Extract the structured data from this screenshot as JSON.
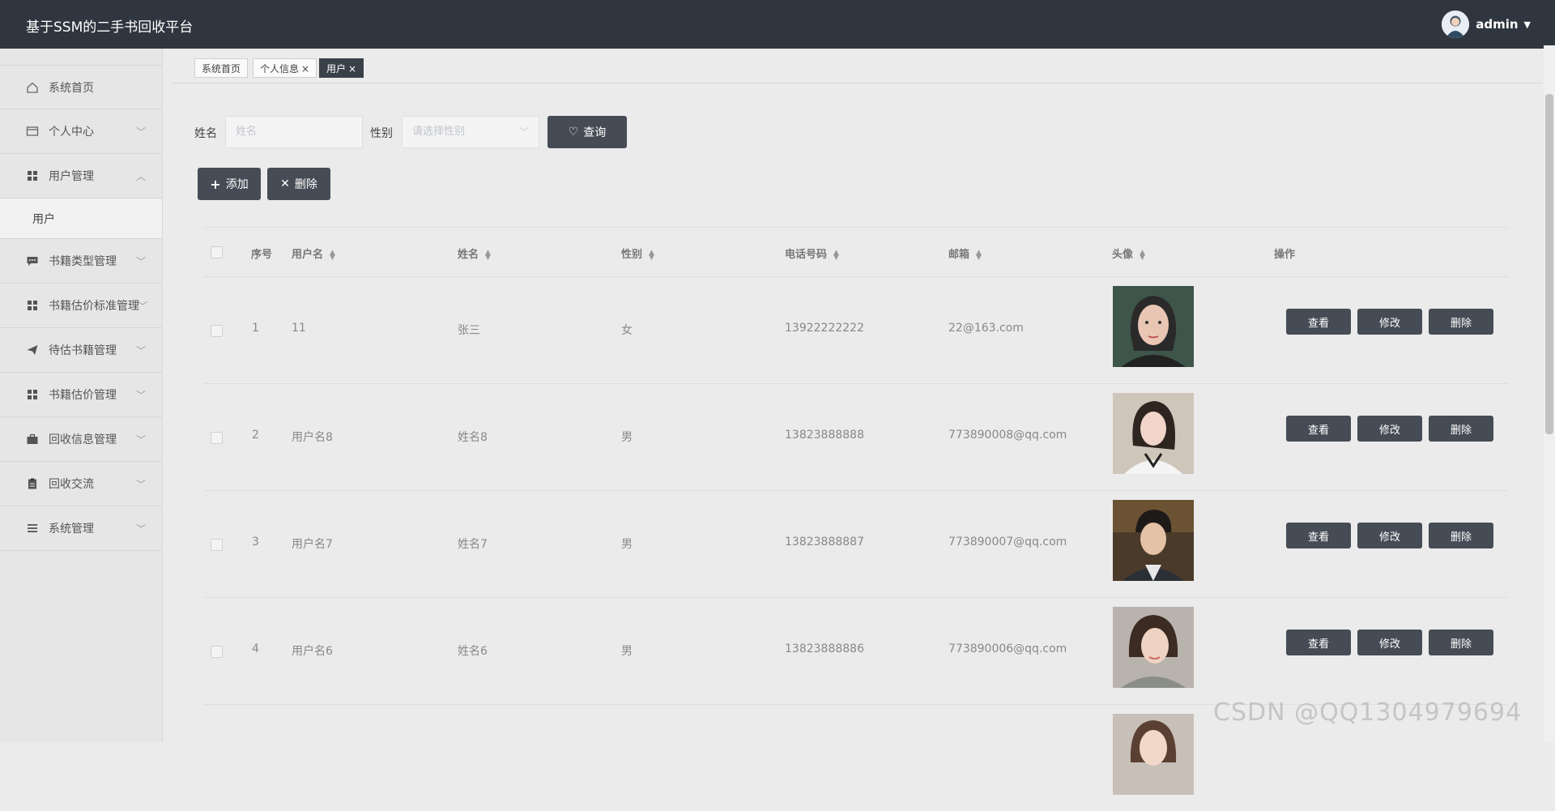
{
  "header": {
    "title": "基于SSM的二手书回收平台",
    "user": "admin"
  },
  "sidebar": {
    "items": [
      {
        "label": "系统首页",
        "icon": "home-icon"
      },
      {
        "label": "个人中心",
        "icon": "wallet-icon"
      },
      {
        "label": "用户管理",
        "icon": "grid-icon"
      },
      {
        "label": "书籍类型管理",
        "icon": "comment-icon"
      },
      {
        "label": "书籍估价标准管理",
        "icon": "grid-icon"
      },
      {
        "label": "待估书籍管理",
        "icon": "send-icon"
      },
      {
        "label": "书籍估价管理",
        "icon": "grid-icon"
      },
      {
        "label": "回收信息管理",
        "icon": "briefcase-icon"
      },
      {
        "label": "回收交流",
        "icon": "clipboard-icon"
      },
      {
        "label": "系统管理",
        "icon": "list-icon"
      }
    ],
    "submenu": {
      "label": "用户"
    }
  },
  "tabs": [
    {
      "label": "系统首页"
    },
    {
      "label": "个人信息",
      "close": "×"
    },
    {
      "label": "用户",
      "close": "×"
    }
  ],
  "search": {
    "name_label": "姓名",
    "name_placeholder": "姓名",
    "gender_label": "性别",
    "gender_placeholder": "请选择性别",
    "query_button": "查询"
  },
  "actions": {
    "add": "添加",
    "delete": "删除"
  },
  "table": {
    "columns": [
      "序号",
      "用户名",
      "姓名",
      "性别",
      "电话号码",
      "邮箱",
      "头像",
      "操作"
    ],
    "rows": [
      {
        "idx": "1",
        "username": "11",
        "name": "张三",
        "gender": "女",
        "phone": "13922222222",
        "email": "22@163.com"
      },
      {
        "idx": "2",
        "username": "用户名8",
        "name": "姓名8",
        "gender": "男",
        "phone": "13823888888",
        "email": "773890008@qq.com"
      },
      {
        "idx": "3",
        "username": "用户名7",
        "name": "姓名7",
        "gender": "男",
        "phone": "13823888887",
        "email": "773890007@qq.com"
      },
      {
        "idx": "4",
        "username": "用户名6",
        "name": "姓名6",
        "gender": "男",
        "phone": "13823888886",
        "email": "773890006@qq.com"
      }
    ],
    "row_buttons": {
      "view": "查看",
      "edit": "修改",
      "delete": "删除"
    }
  },
  "watermark": "CSDN @QQ1304979694",
  "colors": {
    "header_bg": "#30363f",
    "button_bg": "#464c55",
    "sidebar_bg": "#e6e6e6",
    "page_bg": "#ebebeb"
  }
}
